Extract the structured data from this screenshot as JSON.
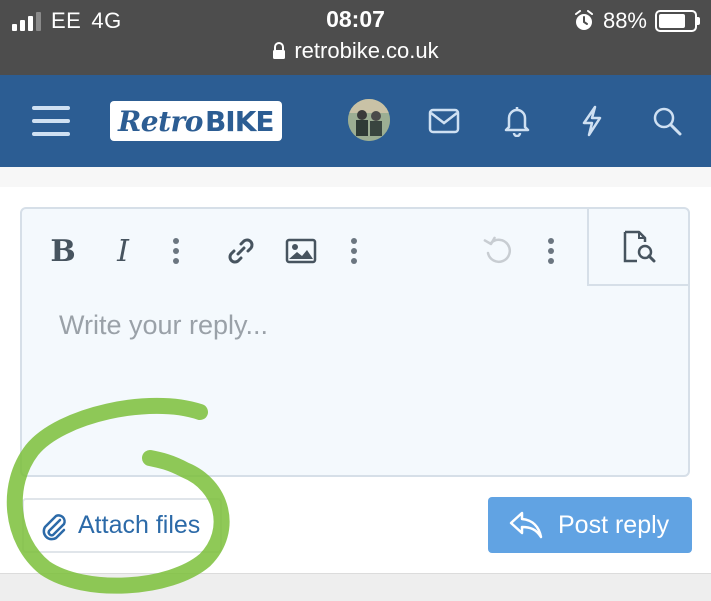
{
  "status_bar": {
    "carrier": "EE",
    "network": "4G",
    "time": "08:07",
    "battery": "88%",
    "battery_level": 0.88,
    "url": "retrobike.co.uk"
  },
  "nav": {
    "logo_part1": "Retro",
    "logo_part2": "BIKE",
    "icons": [
      "menu-icon",
      "avatar",
      "mail-icon",
      "bell-icon",
      "lightning-icon",
      "search-icon"
    ],
    "color": "#2c5d93"
  },
  "editor": {
    "toolbar": [
      "bold",
      "italic",
      "more",
      "link",
      "image",
      "more",
      "undo",
      "more",
      "preview"
    ],
    "bold_label": "B",
    "italic_label": "I",
    "placeholder": "Write your reply..."
  },
  "actions": {
    "attach_label": "Attach files",
    "post_label": "Post reply",
    "post_color": "#61a3e3"
  },
  "annotation": {
    "color": "#7bbf3a"
  }
}
